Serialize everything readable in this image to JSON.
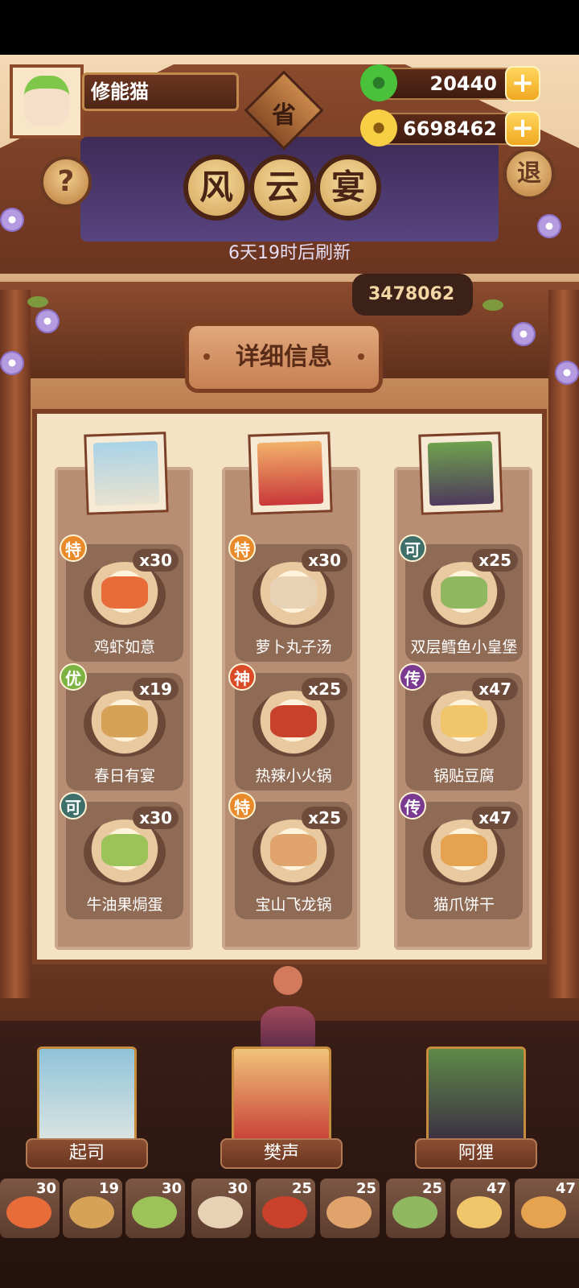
{
  "player": {
    "name": "修能猫"
  },
  "currency": {
    "jade": "20440",
    "coins": "6698462"
  },
  "header": {
    "province_badge": "省",
    "title_chars": [
      "风",
      "云",
      "宴"
    ],
    "help_icon": "?",
    "exit_label": "退",
    "refresh_text": "6天19时后刷新",
    "score": "3478062"
  },
  "detail_sign": "详细信息",
  "columns": [
    {
      "dishes": [
        {
          "rank": "特",
          "count": "x30",
          "name": "鸡虾如意"
        },
        {
          "rank": "优",
          "count": "x19",
          "name": "春日有宴"
        },
        {
          "rank": "可",
          "count": "x30",
          "name": "牛油果焗蛋"
        }
      ]
    },
    {
      "dishes": [
        {
          "rank": "特",
          "count": "x30",
          "name": "萝卜丸子汤"
        },
        {
          "rank": "神",
          "count": "x25",
          "name": "热辣小火锅"
        },
        {
          "rank": "特",
          "count": "x25",
          "name": "宝山飞龙锅"
        }
      ]
    },
    {
      "dishes": [
        {
          "rank": "可",
          "count": "x25",
          "name": "双层鳕鱼小皇堡"
        },
        {
          "rank": "传",
          "count": "x47",
          "name": "锅贴豆腐"
        },
        {
          "rank": "传",
          "count": "x47",
          "name": "猫爪饼干"
        }
      ]
    }
  ],
  "characters": [
    {
      "name": "起司"
    },
    {
      "name": "樊声"
    },
    {
      "name": "阿狸"
    }
  ],
  "strip": [
    {
      "count": "30"
    },
    {
      "count": "19"
    },
    {
      "count": "30"
    },
    {
      "count": "30"
    },
    {
      "count": "25"
    },
    {
      "count": "25"
    },
    {
      "count": "25"
    },
    {
      "count": "47"
    },
    {
      "count": "47"
    }
  ],
  "colors": {
    "rank_te": "#e98a2a",
    "rank_you": "#7cb342",
    "rank_ke": "#3f6f6a",
    "rank_shen": "#d94a26",
    "rank_chuan": "#7a3a8f"
  }
}
